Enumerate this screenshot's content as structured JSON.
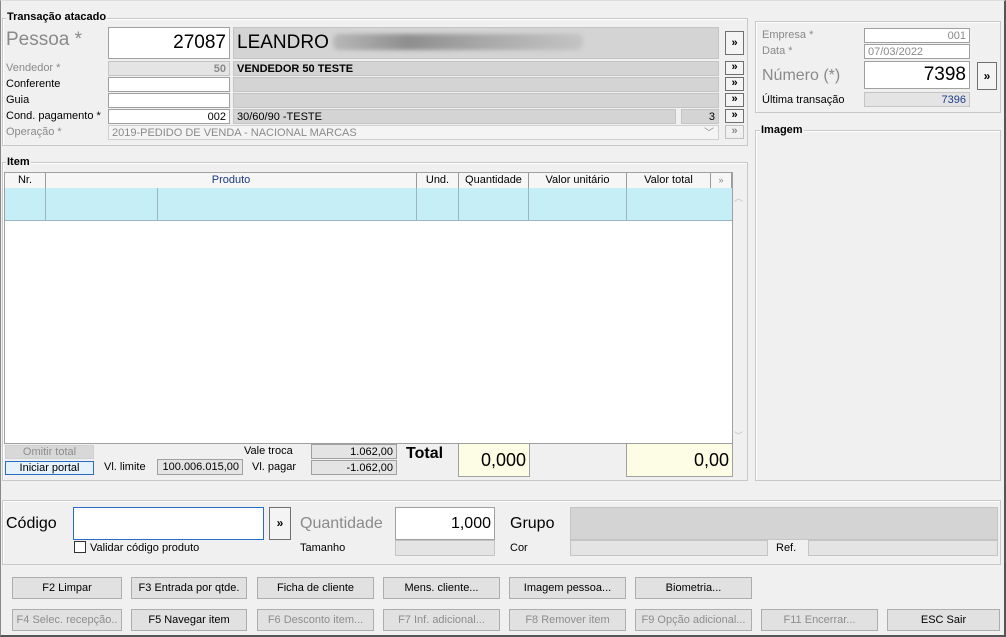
{
  "header": {
    "section_title": "Transação atacado",
    "pessoa_label": "Pessoa *",
    "pessoa_code": "27087",
    "pessoa_name": "LEANDRO",
    "vendedor_label": "Vendedor *",
    "vendedor_code": "50",
    "vendedor_name": "VENDEDOR 50 TESTE",
    "conferente_label": "Conferente",
    "conferente_value": "",
    "guia_label": "Guia",
    "guia_value": "",
    "cond_label": "Cond. pagamento *",
    "cond_code": "002",
    "cond_name": "30/60/90 -TESTE",
    "cond_count": "3",
    "operacao_label": "Operação *",
    "operacao_value": "2019-PEDIDO DE VENDA - NACIONAL MARCAS",
    "arrow_label": "»"
  },
  "right_panel": {
    "empresa_label": "Empresa *",
    "empresa_value": "001",
    "data_label": "Data *",
    "data_value": "07/03/2022",
    "numero_label": "Número (*)",
    "numero_value": "7398",
    "ultima_label": "Última transação",
    "ultima_value": "7396",
    "imagem_title": "Imagem"
  },
  "items": {
    "title": "Item",
    "columns": [
      "Nr.",
      "Produto",
      "Und.",
      "Quantidade",
      "Valor unitário",
      "Valor total"
    ],
    "omitir_total": "Omitir total",
    "iniciar_portal": "Iniciar portal",
    "vl_limite_label": "Vl. limite",
    "vl_limite_value": "100.006.015,00",
    "vale_troca_label": "Vale troca",
    "vale_troca_value": "1.062,00",
    "vl_pagar_label": "Vl. pagar",
    "vl_pagar_value": "-1.062,00",
    "total_label": "Total",
    "total_qty": "0,000",
    "total_value": "0,00"
  },
  "entry": {
    "codigo_label": "Código",
    "codigo_value": "",
    "validar_label": "Validar código produto",
    "quantidade_label": "Quantidade",
    "quantidade_value": "1,000",
    "tamanho_label": "Tamanho",
    "grupo_label": "Grupo",
    "cor_label": "Cor",
    "ref_label": "Ref."
  },
  "buttons": {
    "f2": "F2 Limpar",
    "f3": "F3 Entrada por qtde.",
    "ficha": "Ficha de cliente",
    "mens": "Mens. cliente...",
    "imagem": "Imagem pessoa...",
    "biometria": "Biometria...",
    "f4": "F4 Selec. recepção..",
    "f5": "F5 Navegar item",
    "f6": "F6 Desconto item...",
    "f7": "F7 Inf. adicional...",
    "f8": "F8 Remover item",
    "f9": "F9 Opção adicional...",
    "f11": "F11 Encerrar...",
    "esc": "ESC Sair"
  },
  "colors": {
    "row_selected": "#c6eef7",
    "totals_bg": "#fdfde6",
    "readonly_bg": "#e4e4e4"
  }
}
